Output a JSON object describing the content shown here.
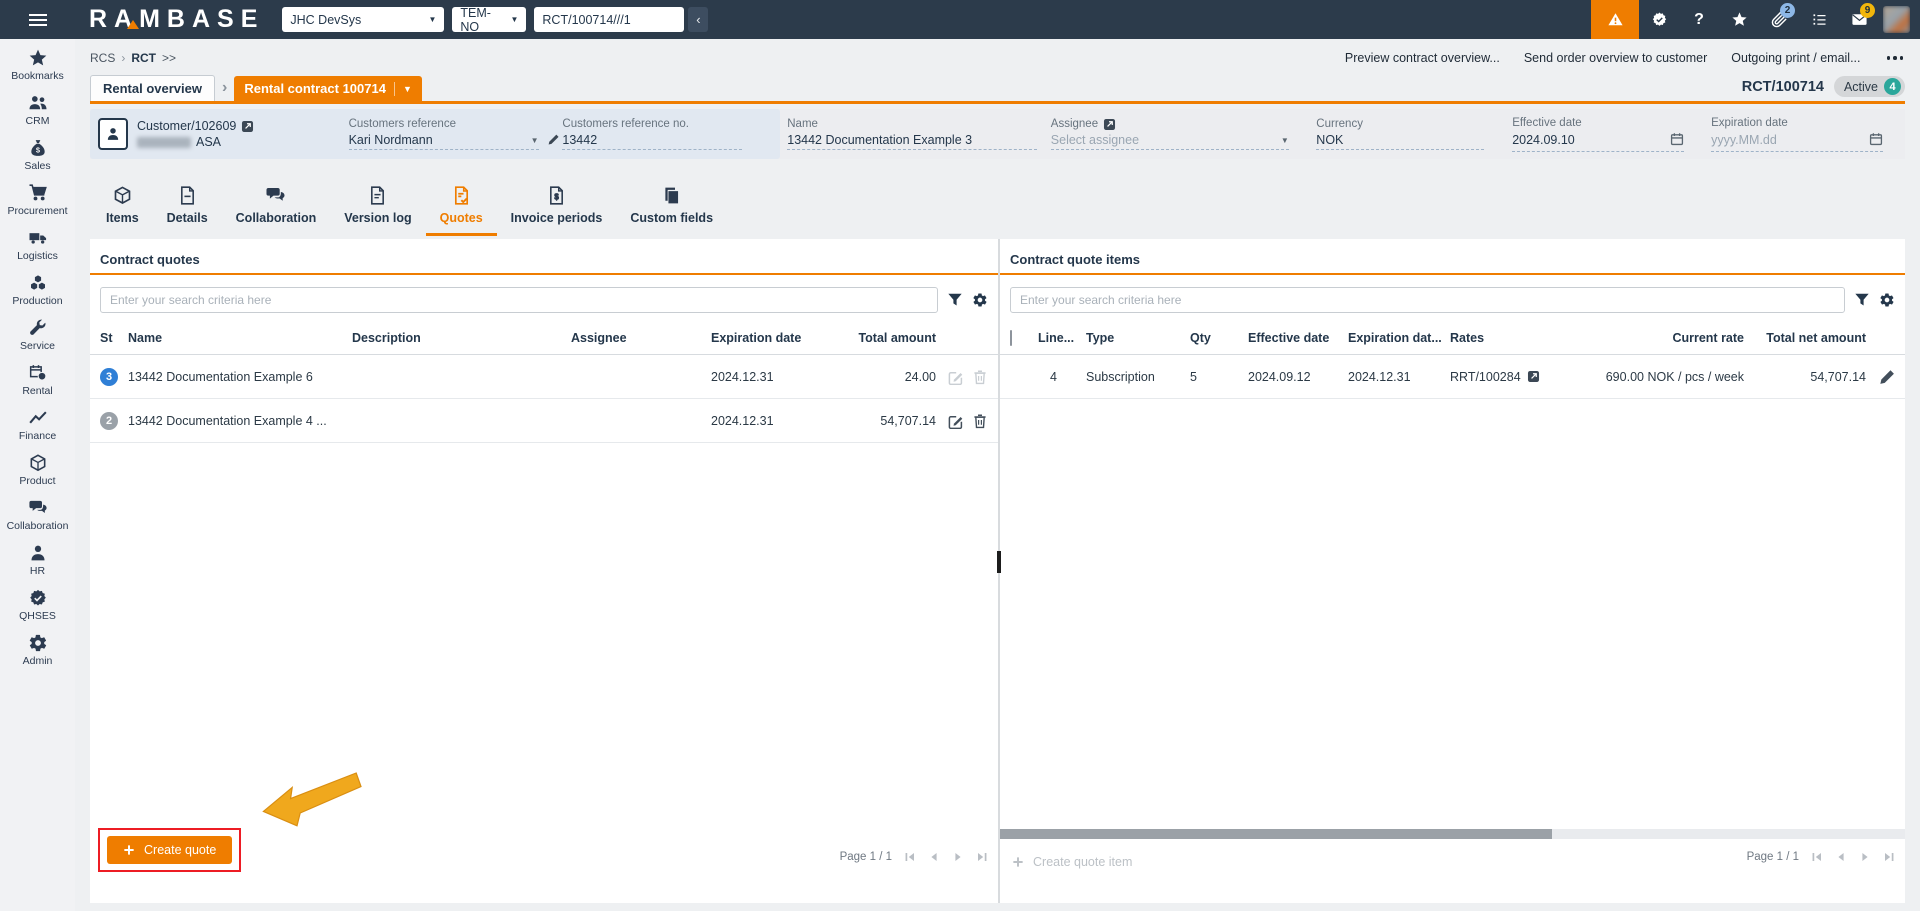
{
  "colors": {
    "accent_orange": "#EF7D00",
    "topbar_navy": "#2C3B4B",
    "active_teal": "#2AA79B",
    "status_blue": "#2F7FD6",
    "status_gray": "#9AA1A8",
    "annotation_red": "#ED1C24",
    "annotation_arrow_yellow": "#F0A81D"
  },
  "topbar": {
    "logo": "RAMBASE",
    "system_select": "JHC DevSys",
    "module_select": "TEM-NO",
    "search_value": "RCT/100714///1",
    "collapse_glyph": "‹",
    "question_glyph": "?",
    "attachment_badge": "2",
    "mail_badge": "9"
  },
  "sidebar": {
    "items": [
      {
        "label": "Bookmarks"
      },
      {
        "label": "CRM"
      },
      {
        "label": "Sales"
      },
      {
        "label": "Procurement"
      },
      {
        "label": "Logistics"
      },
      {
        "label": "Production"
      },
      {
        "label": "Service"
      },
      {
        "label": "Rental"
      },
      {
        "label": "Finance"
      },
      {
        "label": "Product"
      },
      {
        "label": "Collaboration"
      },
      {
        "label": "HR"
      },
      {
        "label": "QHSES"
      },
      {
        "label": "Admin"
      }
    ]
  },
  "breadcrumb": {
    "root": "RCS",
    "separator": "›",
    "current": "RCT",
    "more": ">>"
  },
  "actions": {
    "items": [
      {
        "label": "Preview contract overview..."
      },
      {
        "label": "Send order overview to customer"
      },
      {
        "label": "Outgoing print / email..."
      }
    ]
  },
  "doc_tabs": {
    "overview_tab": "Rental overview",
    "chevron": "›",
    "contract_tab": "Rental contract 100714",
    "contract_caret": "▼",
    "doc_id": "RCT/100714",
    "status_label": "Active",
    "status_count": "4"
  },
  "customer": {
    "link": "Customer/102609",
    "name_suffix": "ASA",
    "reference": {
      "label": "Customers reference",
      "value": "Kari Nordmann",
      "caret": "▼"
    },
    "reference_no": {
      "label": "Customers reference no.",
      "value": "13442"
    },
    "name": {
      "label": "Name",
      "value": "13442 Documentation Example 3"
    },
    "assignee": {
      "label": "Assignee",
      "placeholder": "Select assignee",
      "caret": "▼"
    },
    "currency": {
      "label": "Currency",
      "value": "NOK"
    },
    "effective_date": {
      "label": "Effective date",
      "value": "2024.09.10"
    },
    "expiration_date": {
      "label": "Expiration date",
      "placeholder": "yyyy.MM.dd"
    }
  },
  "tabs": {
    "items": [
      {
        "label": "Items"
      },
      {
        "label": "Details"
      },
      {
        "label": "Collaboration"
      },
      {
        "label": "Version log"
      },
      {
        "label": "Quotes"
      },
      {
        "label": "Invoice periods"
      },
      {
        "label": "Custom fields"
      }
    ]
  },
  "quotes_panel": {
    "title": "Contract quotes",
    "search_placeholder": "Enter your search criteria here",
    "headers": [
      "St",
      "Name",
      "Description",
      "Assignee",
      "Expiration date",
      "Total amount"
    ],
    "rows": [
      {
        "st": "3",
        "name": "13442 Documentation Example 6",
        "description": "",
        "assignee": "",
        "expiration_date": "2024.12.31",
        "total_amount": "24.00"
      },
      {
        "st": "2",
        "name": "13442 Documentation Example 4 ...",
        "description": "",
        "assignee": "",
        "expiration_date": "2024.12.31",
        "total_amount": "54,707.14"
      }
    ],
    "create_button": "Create quote",
    "page_label": "Page 1 / 1"
  },
  "items_panel": {
    "title": "Contract quote items",
    "search_placeholder": "Enter your search criteria here",
    "headers": [
      "Line...",
      "Type",
      "Qty",
      "Effective date",
      "Expiration dat...",
      "Rates",
      "Current rate",
      "Total net amount"
    ],
    "rows": [
      {
        "line": "4",
        "type": "Subscription",
        "qty": "5",
        "effective_date": "2024.09.12",
        "expiration_date": "2024.12.31",
        "rates": "RRT/100284",
        "current_rate": "690.00 NOK / pcs / week",
        "total_net_amount": "54,707.14"
      }
    ],
    "create_button": "Create quote item",
    "page_label": "Page 1 / 1"
  }
}
